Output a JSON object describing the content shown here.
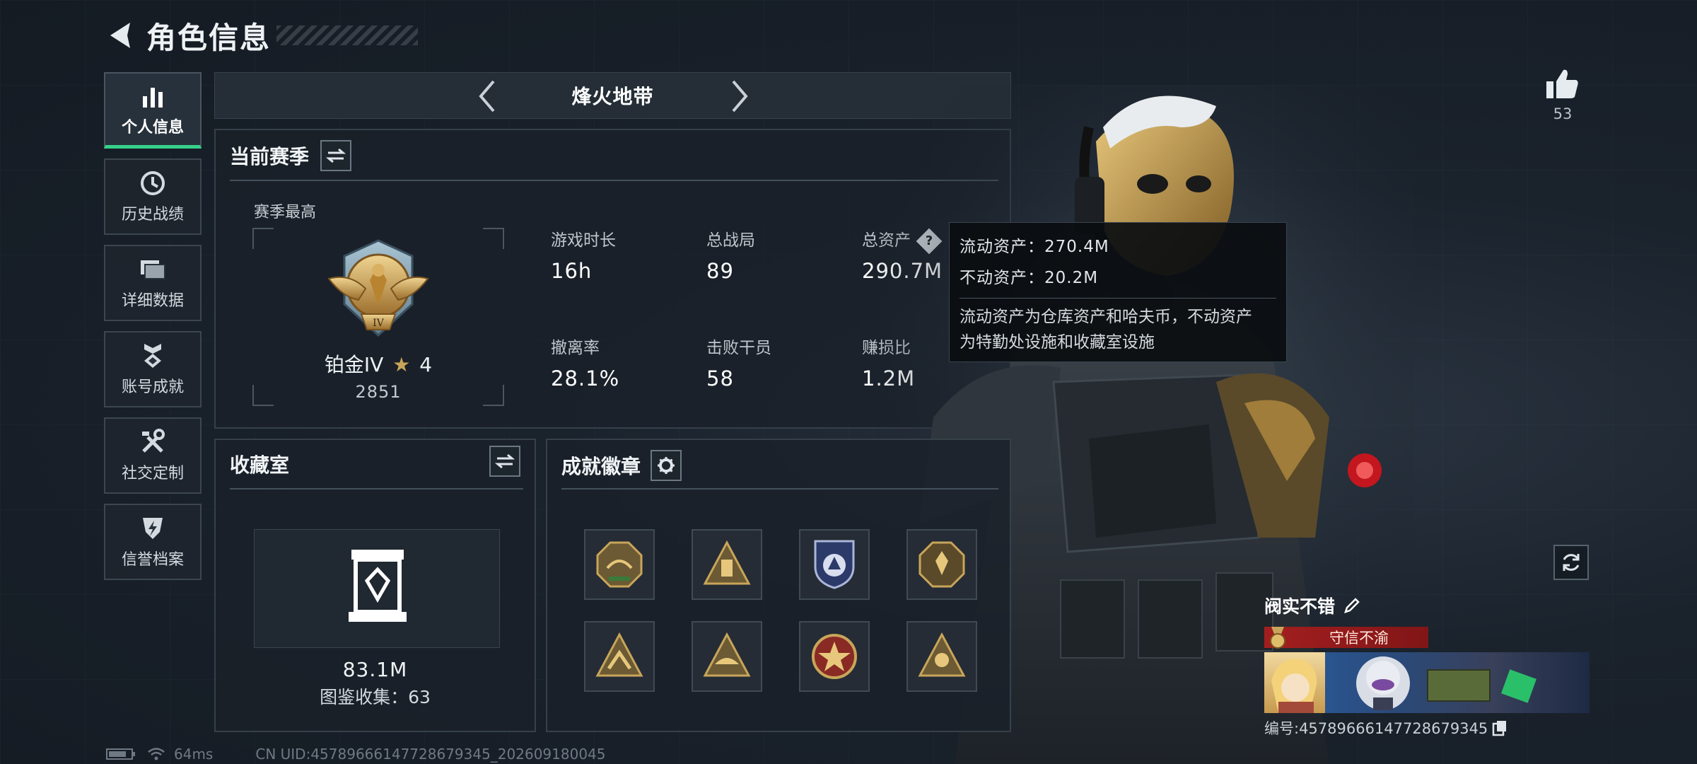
{
  "header": {
    "title": "角色信息"
  },
  "sidebar": {
    "items": [
      {
        "label": "个人信息",
        "icon": "bar-chart-icon",
        "active": true
      },
      {
        "label": "历史战绩",
        "icon": "history-clock-icon",
        "active": false
      },
      {
        "label": "详细数据",
        "icon": "folders-icon",
        "active": false
      },
      {
        "label": "账号成就",
        "icon": "achievement-icon",
        "active": false
      },
      {
        "label": "社交定制",
        "icon": "tools-icon",
        "active": false
      },
      {
        "label": "信誉档案",
        "icon": "shield-bolt-icon",
        "active": false
      }
    ]
  },
  "mode": {
    "title": "烽火地带"
  },
  "season": {
    "title": "当前赛季",
    "best_label": "赛季最高",
    "rank_name": "铂金IV",
    "rank_stars": "4",
    "rank_score": "2851",
    "stats": [
      {
        "label": "游戏时长",
        "value": "16h"
      },
      {
        "label": "总战局",
        "value": "89"
      },
      {
        "label": "总资产",
        "value": "290.7M"
      },
      {
        "label": "撤离率",
        "value": "28.1%"
      },
      {
        "label": "击败干员",
        "value": "58"
      },
      {
        "label": "赚损比",
        "value": "1.2M"
      }
    ]
  },
  "tooltip": {
    "line1": "流动资产：270.4M",
    "line2": "不动资产：20.2M",
    "desc1": "流动资产为仓库资产和哈夫币，不动资产",
    "desc2": "为特勤处设施和收藏室设施"
  },
  "collection": {
    "title": "收藏室",
    "value": "83.1M",
    "count": "图鉴收集：63"
  },
  "badges": {
    "title": "成就徽章"
  },
  "likes": {
    "count": "53"
  },
  "player": {
    "name": "阀实不错",
    "title": "守信不渝",
    "id": "编号:4578966614772867934​5"
  },
  "status": {
    "ping": "64ms",
    "uid": "CN UID:4578966614772867934​5_202609180045"
  },
  "colors": {
    "accent_green": "#36d08a",
    "title_red": "#a81e1e",
    "gold": "#c8a55a"
  }
}
